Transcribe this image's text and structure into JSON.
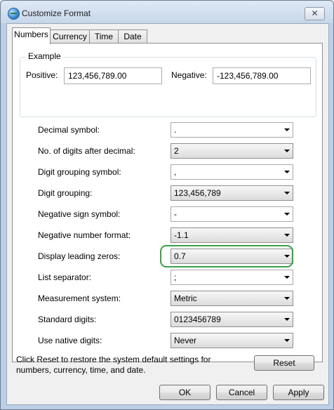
{
  "window": {
    "title": "Customize Format",
    "close_label": "✕"
  },
  "tabs": [
    {
      "label": "Numbers"
    },
    {
      "label": "Currency"
    },
    {
      "label": "Time"
    },
    {
      "label": "Date"
    }
  ],
  "example": {
    "group_label": "Example",
    "positive_label": "Positive:",
    "positive_value": "123,456,789.00",
    "negative_label": "Negative:",
    "negative_value": "-123,456,789.00"
  },
  "settings": [
    {
      "label": "Decimal symbol:",
      "value": "."
    },
    {
      "label": "No. of digits after decimal:",
      "value": "2"
    },
    {
      "label": "Digit grouping symbol:",
      "value": ","
    },
    {
      "label": "Digit grouping:",
      "value": "123,456,789"
    },
    {
      "label": "Negative sign symbol:",
      "value": "-"
    },
    {
      "label": "Negative number format:",
      "value": "-1.1"
    },
    {
      "label": "Display leading zeros:",
      "value": "0.7"
    },
    {
      "label": "List separator:",
      "value": ";"
    },
    {
      "label": "Measurement system:",
      "value": "Metric"
    },
    {
      "label": "Standard digits:",
      "value": "0123456789"
    },
    {
      "label": "Use native digits:",
      "value": "Never"
    }
  ],
  "reset": {
    "text": "Click Reset to restore the system default settings for numbers, currency, time, and date.",
    "button": "Reset"
  },
  "footer": {
    "ok": "OK",
    "cancel": "Cancel",
    "apply": "Apply"
  },
  "colors": {
    "highlight": "#3aa04a",
    "titlebar": "#c6d6ea"
  }
}
